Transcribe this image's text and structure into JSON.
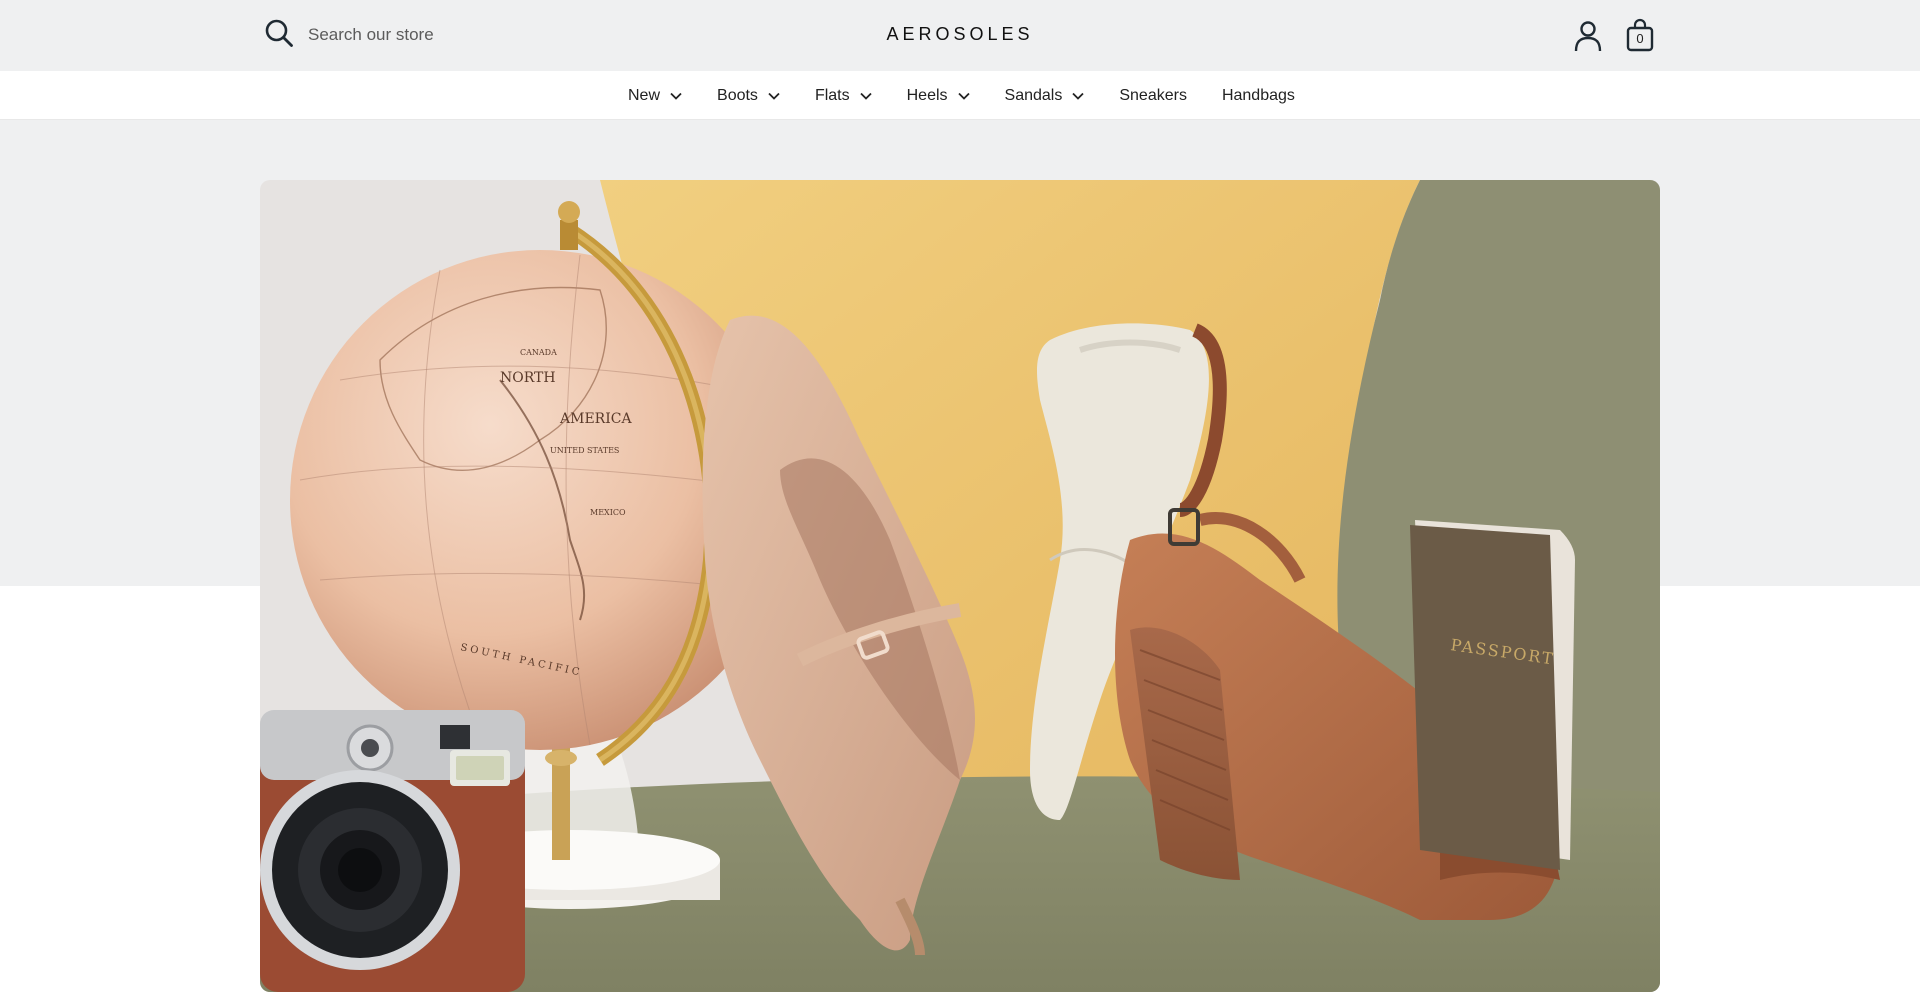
{
  "header": {
    "search": {
      "placeholder": "Search our store",
      "icon": "search-icon"
    },
    "logo": "AEROSOLES",
    "account_icon": "account-icon",
    "cart": {
      "icon": "shopping-bag-icon",
      "count": "0"
    }
  },
  "nav": {
    "items": [
      {
        "label": "New",
        "has_dropdown": true
      },
      {
        "label": "Boots",
        "has_dropdown": true
      },
      {
        "label": "Flats",
        "has_dropdown": true
      },
      {
        "label": "Heels",
        "has_dropdown": true
      },
      {
        "label": "Sandals",
        "has_dropdown": true
      },
      {
        "label": "Sneakers",
        "has_dropdown": false
      },
      {
        "label": "Handbags",
        "has_dropdown": false
      }
    ]
  },
  "hero": {
    "passport_text": "PASSPORT",
    "globe_text": [
      "NORTH",
      "AMERICA",
      "UNITED STATES",
      "MEXICO",
      "CANADA",
      "SOUTH PACIFIC"
    ]
  },
  "colors": {
    "header_bg": "#eff0f1",
    "yellow_wall": "#edc571",
    "olive_surface": "#8e8f6d",
    "tan_leather": "#b9714a"
  }
}
